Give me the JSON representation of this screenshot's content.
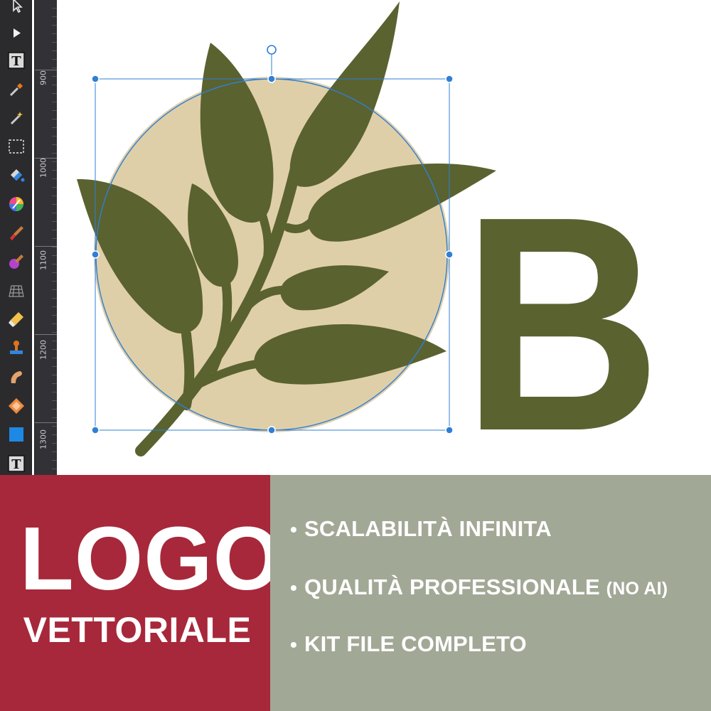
{
  "app": {
    "tools": [
      {
        "name": "pointer-icon",
        "glyph": "↖"
      },
      {
        "name": "node-select-icon",
        "glyph": "▶"
      },
      {
        "name": "text-tool-icon",
        "glyph": "T"
      },
      {
        "name": "eyedropper-icon",
        "glyph": ""
      },
      {
        "name": "magic-wand-icon",
        "glyph": ""
      },
      {
        "name": "marquee-select-icon",
        "glyph": ""
      },
      {
        "name": "fill-bucket-icon",
        "glyph": ""
      },
      {
        "name": "color-wheel-icon",
        "glyph": ""
      },
      {
        "name": "paint-brush-icon",
        "glyph": ""
      },
      {
        "name": "color-brush-icon",
        "glyph": ""
      },
      {
        "name": "grid-mesh-icon",
        "glyph": ""
      },
      {
        "name": "eraser-icon",
        "glyph": ""
      },
      {
        "name": "stamp-icon",
        "glyph": ""
      },
      {
        "name": "smudge-icon",
        "glyph": ""
      },
      {
        "name": "shape-diamond-icon",
        "glyph": ""
      },
      {
        "name": "rectangle-icon",
        "glyph": ""
      },
      {
        "name": "artistic-text-icon",
        "glyph": "T"
      }
    ],
    "ruler": {
      "labels": [
        "900",
        "1000",
        "1100",
        "1200",
        "1300"
      ]
    },
    "canvas": {
      "monogram_letter": "B",
      "colors": {
        "leaf": "#5a6230",
        "circle": "#dfcfa9",
        "selection": "#2f7fd6"
      }
    }
  },
  "banner": {
    "title": "LOGO",
    "subtitle": "VETTORIALE",
    "features": [
      {
        "text": "SCALABILITÀ INFINITA",
        "suffix": ""
      },
      {
        "text": "QUALITÀ PROFESSIONALE",
        "suffix": "(NO AI)"
      },
      {
        "text": "KIT FILE COMPLETO",
        "suffix": ""
      }
    ],
    "bullet": "•",
    "colors": {
      "left": "#a7283a",
      "right": "#a2a896"
    }
  }
}
